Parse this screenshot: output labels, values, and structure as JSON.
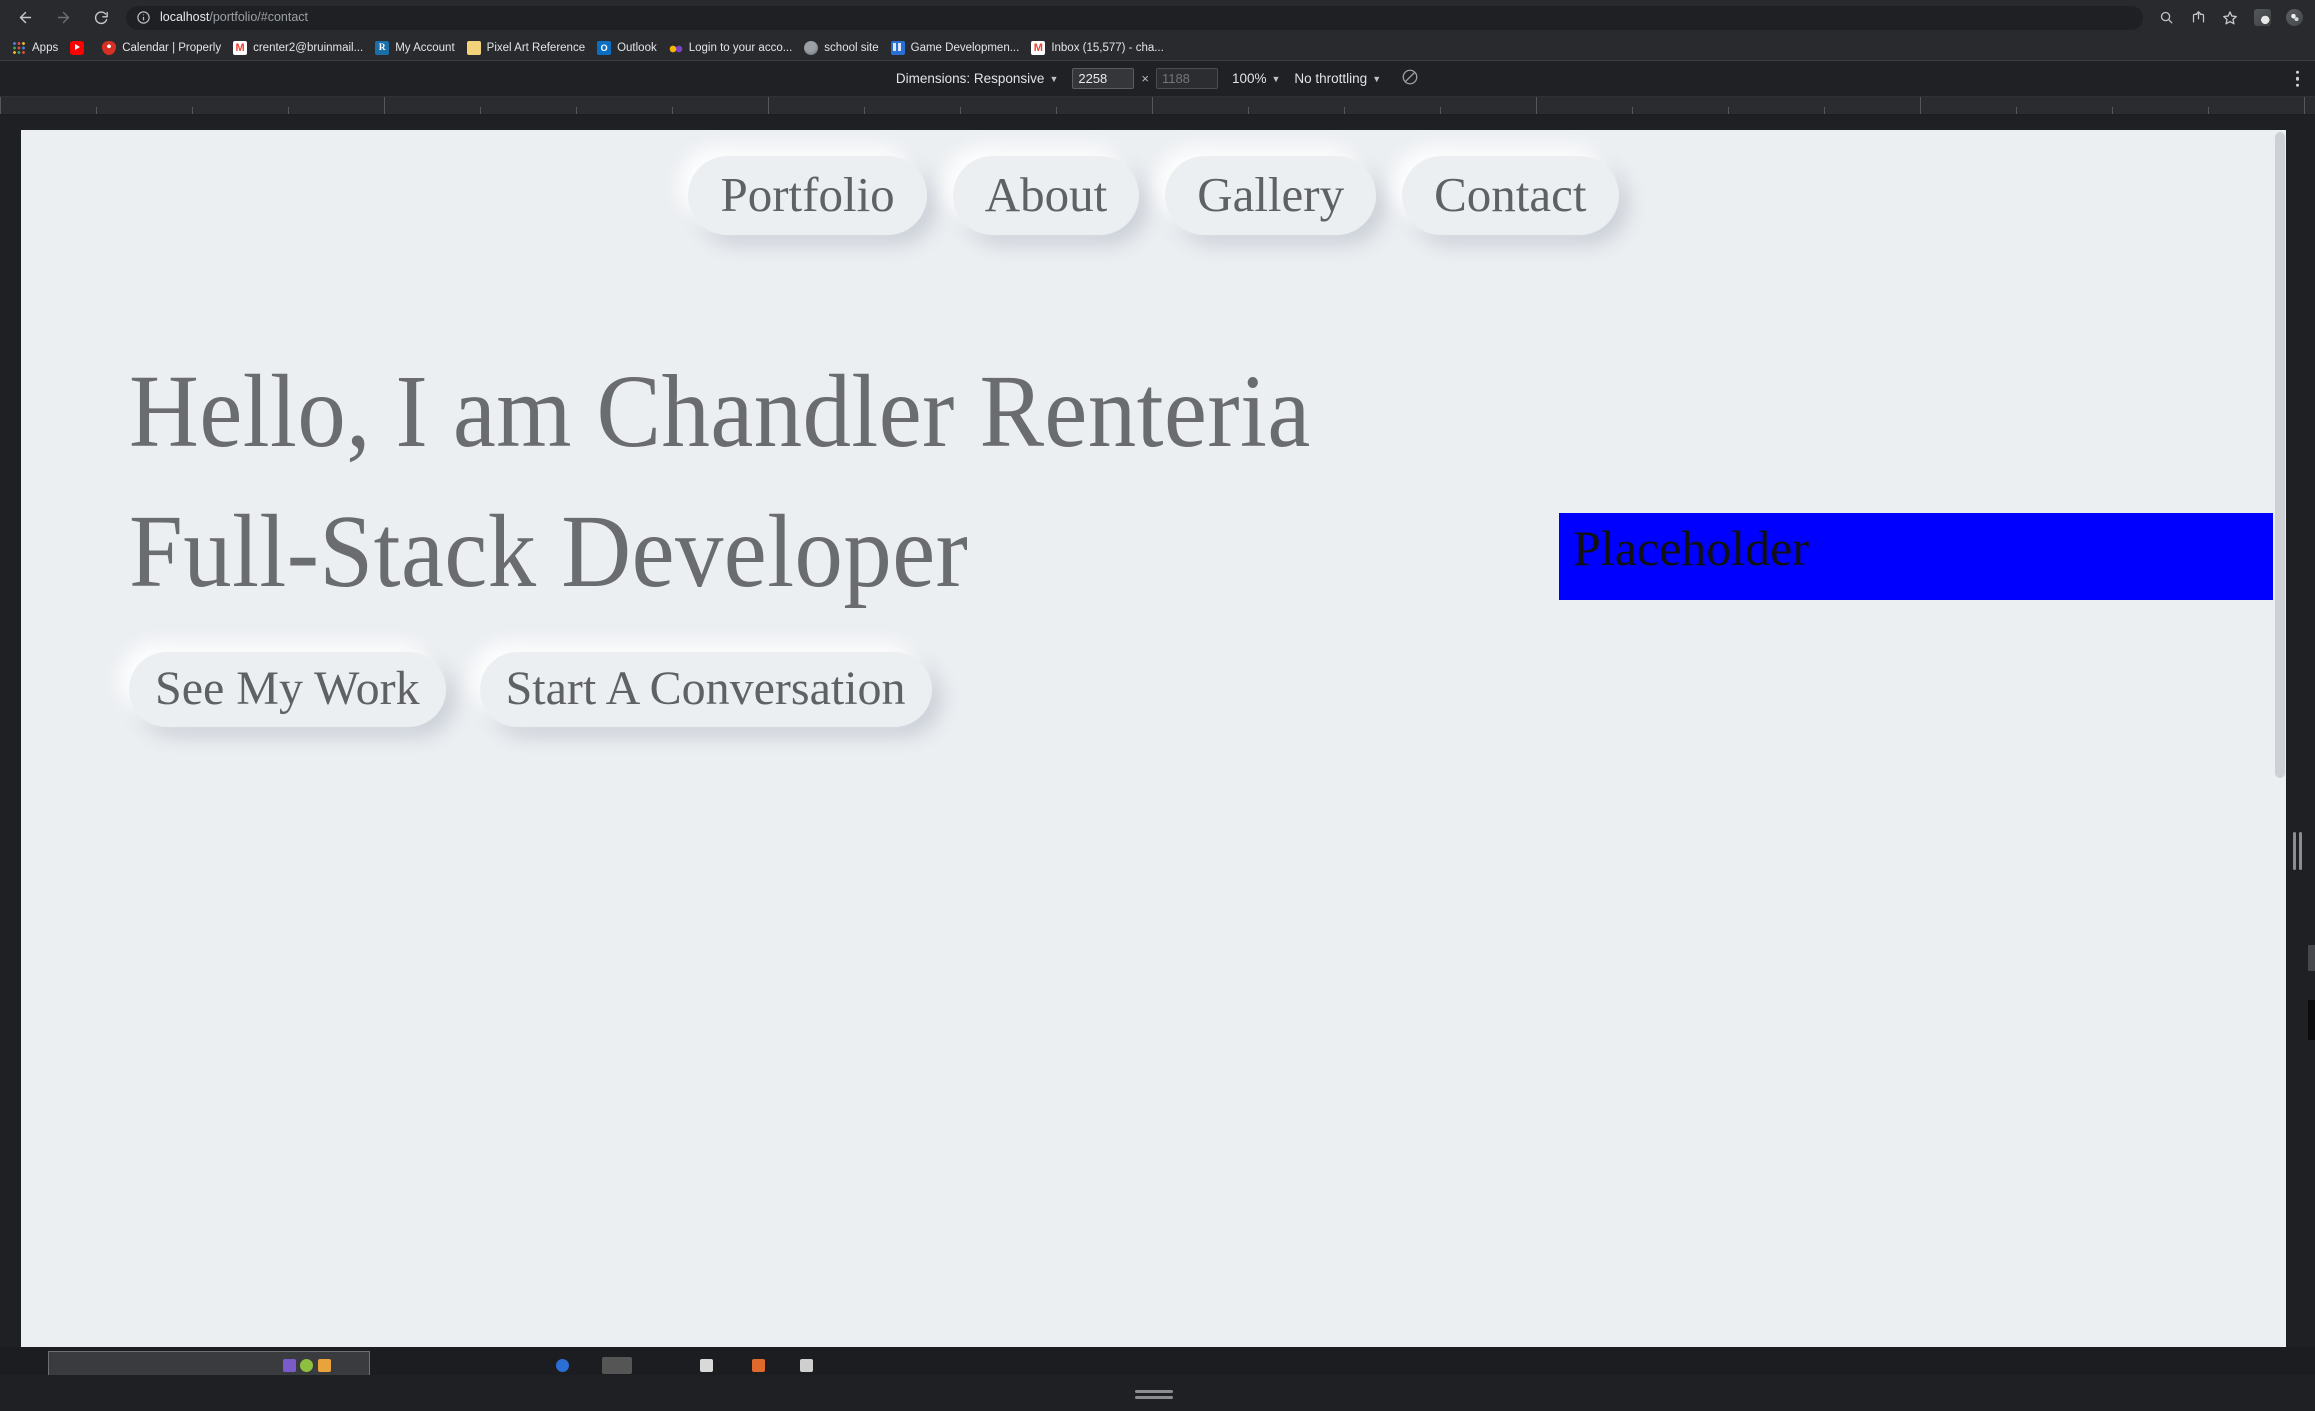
{
  "browser": {
    "nav": {
      "back_title": "Back",
      "forward_title": "Forward",
      "reload_title": "Reload"
    },
    "omnibox": {
      "host": "localhost",
      "path": "/portfolio/#contact",
      "full_url": "localhost/portfolio/#contact",
      "site_info_title": "View site information"
    },
    "toolbar_right": [
      {
        "name": "search-icon",
        "title": "Search"
      },
      {
        "name": "share-icon",
        "title": "Share this page"
      },
      {
        "name": "bookmark-star-icon",
        "title": "Bookmark this tab"
      },
      {
        "name": "extension-icon-a",
        "title": "Extension"
      },
      {
        "name": "extension-icon-b",
        "title": "Extension"
      }
    ],
    "bookmarks": [
      {
        "label": "Apps",
        "icon": "apps-grid-icon"
      },
      {
        "label": "",
        "icon": "youtube-icon"
      },
      {
        "label": "Calendar | Properly",
        "icon": "location-pin-icon"
      },
      {
        "label": "crenter2@bruinmail...",
        "icon": "gmail-icon"
      },
      {
        "label": "My Account",
        "icon": "rx-icon"
      },
      {
        "label": "Pixel Art Reference",
        "icon": "folder-icon"
      },
      {
        "label": "Outlook",
        "icon": "outlook-icon"
      },
      {
        "label": "Login to your acco...",
        "icon": "cc-icon"
      },
      {
        "label": "school site",
        "icon": "globe-icon"
      },
      {
        "label": "Game Developmen...",
        "icon": "trello-icon"
      },
      {
        "label": "Inbox (15,577) - cha...",
        "icon": "gmail-icon"
      }
    ]
  },
  "devtools": {
    "device_toolbar": {
      "dimensions_label": "Dimensions: Responsive",
      "width_value": "2258",
      "height_value": "1188",
      "height_placeholder": "1188",
      "zoom_label": "100%",
      "throttling_label": "No throttling",
      "rotate_title": "Rotate",
      "menu_title": "More options"
    }
  },
  "page": {
    "background_color": "#eceff2",
    "nav_items": [
      {
        "label": "Portfolio"
      },
      {
        "label": "About"
      },
      {
        "label": "Gallery"
      },
      {
        "label": "Contact"
      }
    ],
    "hero": {
      "heading": "Hello, I am Chandler Renteria",
      "subheading": "Full-Stack Developer",
      "buttons": [
        {
          "label": "See My Work"
        },
        {
          "label": "Start A Conversation"
        }
      ]
    },
    "placeholder": {
      "label": "Placeholder",
      "color": "#0000ff"
    }
  }
}
